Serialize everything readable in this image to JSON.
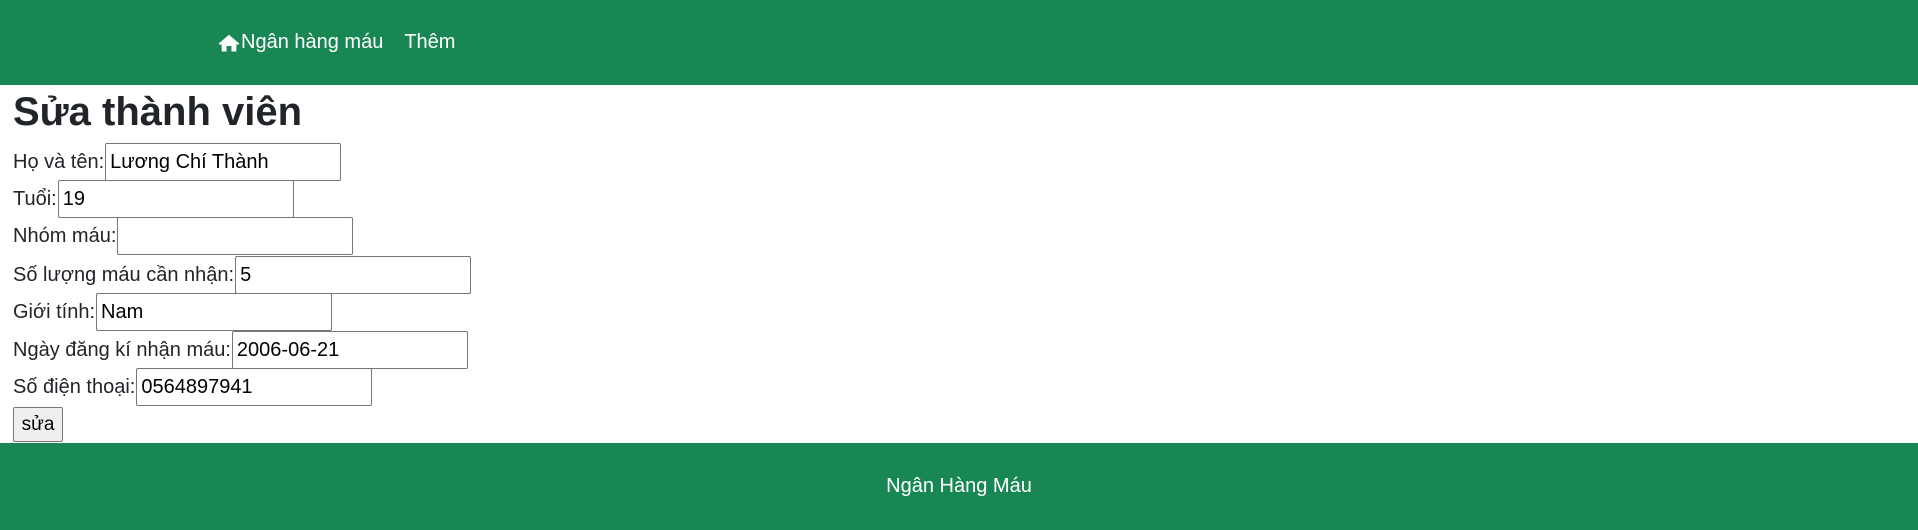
{
  "navbar": {
    "brand_icon": "home-icon",
    "brand_label": "Ngân hàng máu",
    "more_label": "Thêm"
  },
  "page": {
    "title": "Sửa thành viên"
  },
  "form": {
    "fields": [
      {
        "label": "Họ và tên:",
        "value": "Lương Chí Thành"
      },
      {
        "label": "Tuổi:",
        "value": "19"
      },
      {
        "label": "Nhóm máu:",
        "value": ""
      },
      {
        "label": "Số lượng máu cần nhận:",
        "value": "5"
      },
      {
        "label": "Giới tính:",
        "value": "Nam"
      },
      {
        "label": "Ngày đăng kí nhận máu:",
        "value": "2006-06-21"
      },
      {
        "label": "Số điện thoại:",
        "value": "0564897941"
      }
    ],
    "submit_label": "sửa"
  },
  "footer": {
    "text": "Ngân Hàng Máu"
  },
  "colors": {
    "brand": "#198754",
    "text": "#212529"
  }
}
